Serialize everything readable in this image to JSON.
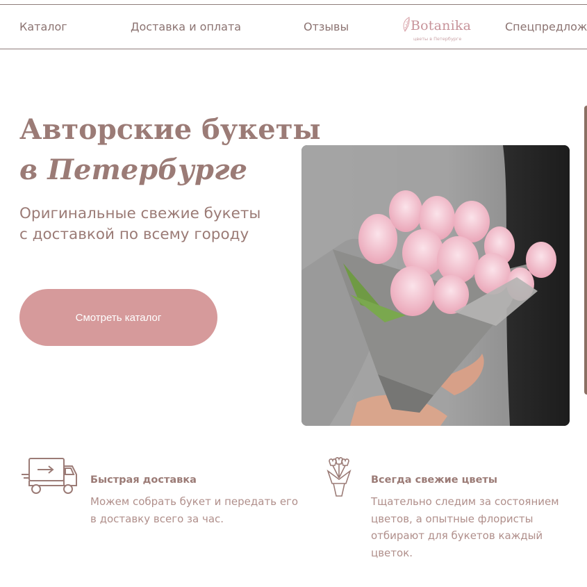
{
  "nav": {
    "catalog": "Каталог",
    "delivery": "Доставка и оплата",
    "reviews": "Отзывы",
    "special": "Спецпредлож"
  },
  "logo": {
    "name": "Botanika",
    "tagline": "цветы в Петербурге"
  },
  "hero": {
    "title_line1": "Авторские букеты",
    "title_line2": "в Петербурге",
    "subtitle_line1": "Оригинальные свежие букеты",
    "subtitle_line2": "с доставкой по всему городу",
    "cta_label": "Смотреть каталог"
  },
  "features": [
    {
      "icon": "delivery-truck-icon",
      "title": "Быстрая доставка",
      "text": "Можем собрать букет и передать его в доставку всего за час."
    },
    {
      "icon": "tulip-bouquet-icon",
      "title": "Всегда свежие цветы",
      "text": "Тщательно следим за состоянием цветов, а опытные флористы отбирают для букетов каждый цветок."
    }
  ],
  "colors": {
    "accent": "#d69a9b",
    "text": "#9b7b76",
    "border": "#8e7c7a"
  }
}
